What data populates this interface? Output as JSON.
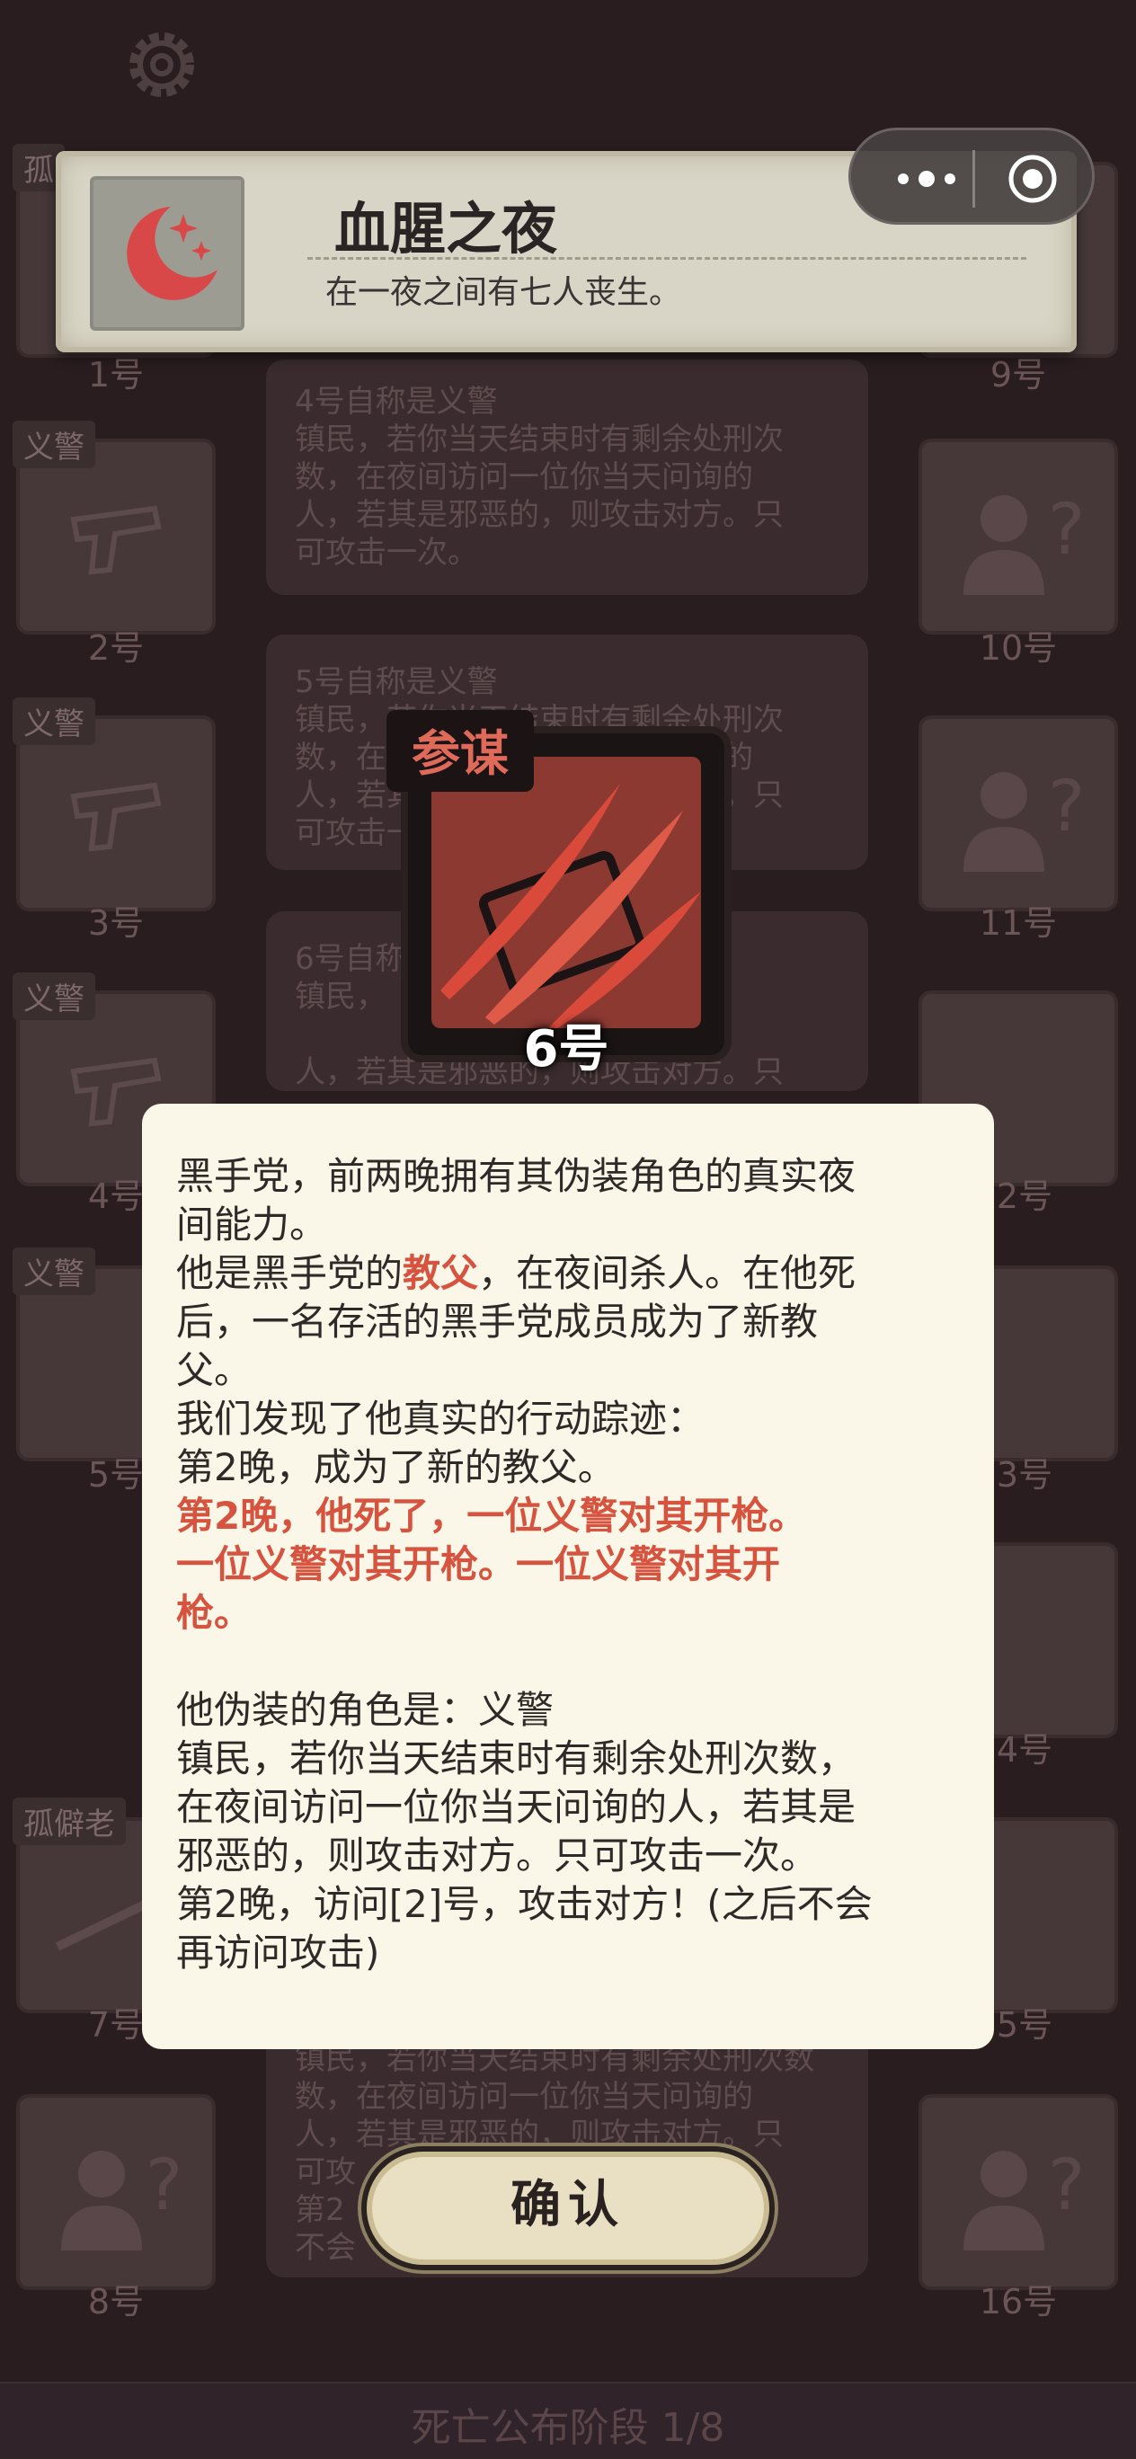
{
  "event_banner": {
    "title": "血腥之夜",
    "subtitle": "在一夜之间有七人丧生。",
    "icon": "moon-stars-icon"
  },
  "capsule": {
    "menu_icon": "more-dots-icon",
    "close_icon": "target-circle-icon"
  },
  "settings": {
    "icon": "gear-icon"
  },
  "left_column": [
    {
      "tag": "孤",
      "num": "1号"
    },
    {
      "tag": "义警",
      "num": "2号"
    },
    {
      "tag": "义警",
      "num": "3号"
    },
    {
      "tag": "义警",
      "num": "4号"
    },
    {
      "tag": "义警",
      "num": "5号"
    },
    {
      "tag": "",
      "num": "6号"
    },
    {
      "tag": "孤僻老",
      "num": "7号"
    },
    {
      "tag": "",
      "num": "8号"
    }
  ],
  "right_column": [
    {
      "num": "9号"
    },
    {
      "num": "10号"
    },
    {
      "num": "11号"
    },
    {
      "num": "2号"
    },
    {
      "num": "3号"
    },
    {
      "num": "4号"
    },
    {
      "num": "5号"
    },
    {
      "num": "16号"
    }
  ],
  "cards": [
    {
      "lines": [
        "4号自称是义警",
        "镇民，若你当天结束时有剩余处刑次",
        "数，在夜间访问一位你当天问询的",
        "人，若其是邪恶的，则攻击对方。只",
        "可攻击一次。"
      ]
    },
    {
      "lines": [
        "5号自称是义警",
        "镇民，若你当天结束时有剩余处刑次",
        "数，在夜间访问一位你当天问询的",
        "人，若其是邪恶的，则攻击对方。只",
        "可攻击一次。"
      ]
    },
    {
      "lines": [
        "6号自称",
        "镇民，",
        "人，若其是邪恶的，则攻击对方。只"
      ]
    },
    {
      "lines": [
        "镇民，若你当天结束时有剩余处刑次数",
        "数，在夜间访问一位你当天问询的",
        "人，若其是邪恶的，则攻击对方。只",
        "可攻",
        "第2",
        "不会"
      ]
    }
  ],
  "role_card": {
    "label": "参谋",
    "number": "6号",
    "icon": "claw-slash-icon"
  },
  "dialog": {
    "line1": "黑手党，前两晚拥有其伪装角色的真实夜",
    "line2": "间能力。",
    "line3_pre": "他是黑手党的",
    "line3_red": "教父",
    "line3_post": "，在夜间杀人。在他死",
    "line4": "后，一名存活的黑手党成员成为了新教",
    "line5": "父。",
    "line6": "我们发现了他真实的行动踪迹：",
    "line7": "第2晚，成为了新的教父。",
    "red1": "第2晚，他死了，一位义警对其开枪。",
    "red2": "一位义警对其开枪。一位义警对其开",
    "red3": "枪。",
    "line8": "他伪装的角色是：义警",
    "line9": "镇民，若你当天结束时有剩余处刑次数，",
    "line10": "在夜间访问一位你当天问询的人，若其是",
    "line11": "邪恶的，则攻击对方。只可攻击一次。",
    "line12": "第2晚，访问[2]号，攻击对方！(之后不会",
    "line13": "再访问攻击)"
  },
  "confirm_button": {
    "label": "确认"
  },
  "phase": {
    "text": "死亡公布阶段 1/8"
  },
  "colors": {
    "background": "#2a1d1f",
    "dialog_bg": "#faf7e8",
    "accent_red": "#d6543f",
    "role_red": "#8c3932"
  }
}
